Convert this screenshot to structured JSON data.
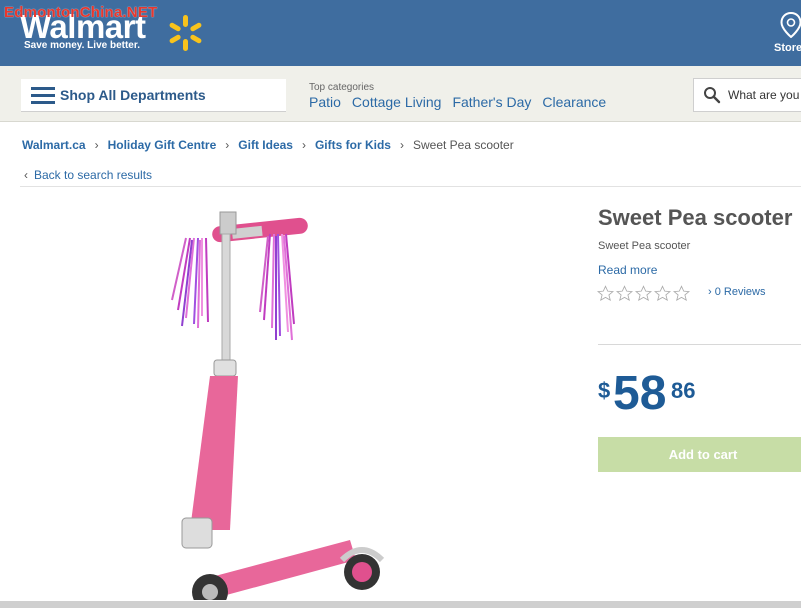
{
  "watermark": "EdmontonChina.NET",
  "header": {
    "logo_text": "Walmart",
    "tagline": "Save money. Live better.",
    "store_label": "Store"
  },
  "nav": {
    "shop_all": "Shop All Departments",
    "top_categories_label": "Top categories",
    "top_categories": [
      "Patio",
      "Cottage Living",
      "Father's Day",
      "Clearance"
    ],
    "search_placeholder": "What are you"
  },
  "breadcrumb": [
    "Walmart.ca",
    "Holiday Gift Centre",
    "Gift Ideas",
    "Gifts for Kids"
  ],
  "breadcrumb_current": "Sweet Pea scooter",
  "back_link": "Back to search results",
  "product": {
    "title": "Sweet Pea scooter",
    "subtitle": "Sweet Pea scooter",
    "read_more": "Read more",
    "rating": 0,
    "rating_max": 5,
    "reviews": "› 0 Reviews",
    "price_currency": "$",
    "price_dollars": "58",
    "price_cents": "86",
    "add_to_cart": "Add to cart"
  },
  "colors": {
    "header": "#3f6d9f",
    "link": "#2c6aa6",
    "price": "#1e5b96",
    "add_to_cart": "#c7dda6",
    "spark": "#f8c31c",
    "scooter": "#e8679a"
  }
}
